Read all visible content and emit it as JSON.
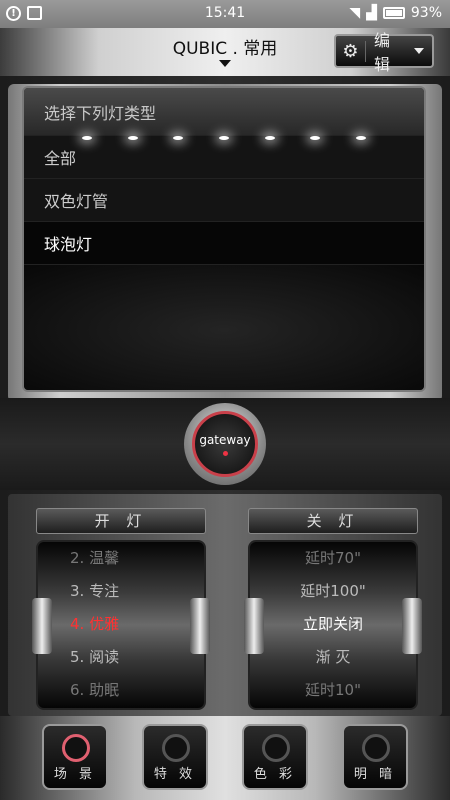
{
  "status_bar": {
    "time": "15:41",
    "battery": "93%",
    "alert_glyph": "!"
  },
  "header": {
    "title": "QUBIC . 常用",
    "edit_label": "编 辑"
  },
  "light_type_list": {
    "prompt": "选择下列灯类型",
    "items": [
      "全部",
      "双色灯管",
      "球泡灯"
    ],
    "selected": "球泡灯"
  },
  "gateway": {
    "label": "gateway"
  },
  "on_panel": {
    "title": "开 灯",
    "items": [
      "2. 温馨",
      "3. 专注",
      "4. 优雅",
      "5. 阅读",
      "6. 助眠"
    ],
    "selected": "4. 优雅"
  },
  "off_panel": {
    "title": "关 灯",
    "items": [
      "延时70\"",
      "延时100\"",
      "立即关闭",
      "渐 灭",
      "延时10\""
    ],
    "selected": "立即关闭"
  },
  "bottom_nav": {
    "items": [
      "场 景",
      "特 效",
      "色 彩",
      "明 暗"
    ],
    "active": "场 景"
  },
  "colors": {
    "accent_red": "#ff3232",
    "ring_active": "#e06070"
  }
}
